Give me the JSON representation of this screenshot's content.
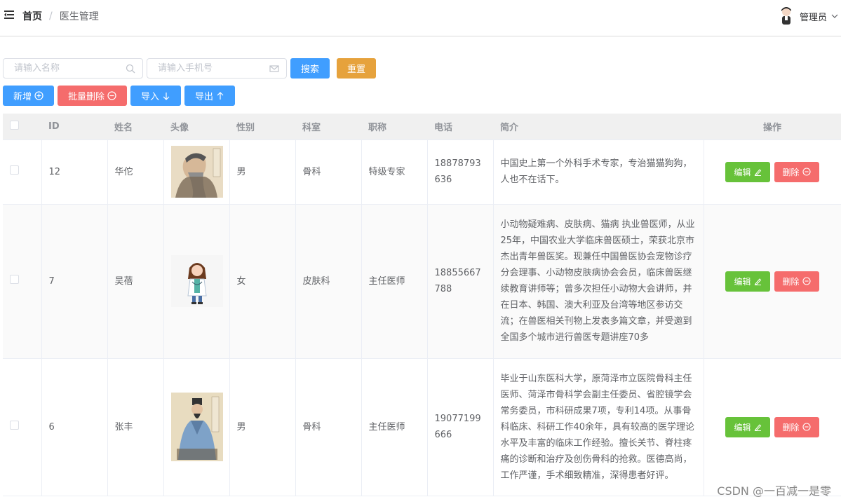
{
  "header": {
    "breadcrumb_home": "首页",
    "breadcrumb_sep": "/",
    "breadcrumb_current": "医生管理",
    "user_name": "管理员"
  },
  "search": {
    "name_placeholder": "请输入名称",
    "phone_placeholder": "请输入手机号",
    "search_label": "搜索",
    "reset_label": "重置"
  },
  "actions": {
    "add_label": "新增",
    "batch_delete_label": "批量删除",
    "import_label": "导入",
    "export_label": "导出"
  },
  "table": {
    "columns": [
      "ID",
      "姓名",
      "头像",
      "性别",
      "科室",
      "职称",
      "电话",
      "简介",
      "操作"
    ],
    "edit_label": "编辑",
    "delete_label": "删除",
    "rows": [
      {
        "id": "12",
        "name": "华佗",
        "gender": "男",
        "dept": "骨科",
        "title": "特级专家",
        "phone": "18878793636",
        "intro": "中国史上第一个外科手术专家，专治猫猫狗狗，人也不在话下。"
      },
      {
        "id": "7",
        "name": "吴蓓",
        "gender": "女",
        "dept": "皮肤科",
        "title": "主任医师",
        "phone": "18855667788",
        "intro": "小动物疑难病、皮肤病、猫病 执业兽医师，从业25年，中国农业大学临床兽医硕士，荣获北京市杰出青年兽医奖。现兼任中国兽医协会宠物诊疗分会理事、小动物皮肤病协会会员，临床兽医继续教育讲师等；曾多次担任小动物大会讲师，并在日本、韩国、澳大利亚及台湾等地区参访交流；在兽医相关刊物上发表多篇文章，并受邀到全国多个城市进行兽医专题讲座70多"
      },
      {
        "id": "6",
        "name": "张丰",
        "gender": "男",
        "dept": "骨科",
        "title": "主任医师",
        "phone": "19077199666",
        "intro": "毕业于山东医科大学，原菏泽市立医院骨科主任医师、菏泽市骨科学会副主任委员、省腔镜学会常务委员，市科研成果7项，专利14项。从事骨科临床、科研工作40余年，具有较高的医学理论水平及丰富的临床工作经验。擅长关节、脊柱疼痛的诊断和治疗及创伤骨科的抢救。医德高尚，工作严谨，手术细致精准，深得患者好评。"
      }
    ]
  },
  "watermark": "CSDN @一百减一是零",
  "colors": {
    "primary": "#409eff",
    "success": "#67c23a",
    "warning": "#e6a23c",
    "danger": "#f56c6c"
  },
  "icons": [
    "menu-fold-icon",
    "search-icon",
    "message-icon",
    "circle-plus-icon",
    "circle-minus-icon",
    "arrow-down-icon",
    "arrow-up-icon",
    "edit-icon",
    "chevron-down-icon"
  ]
}
